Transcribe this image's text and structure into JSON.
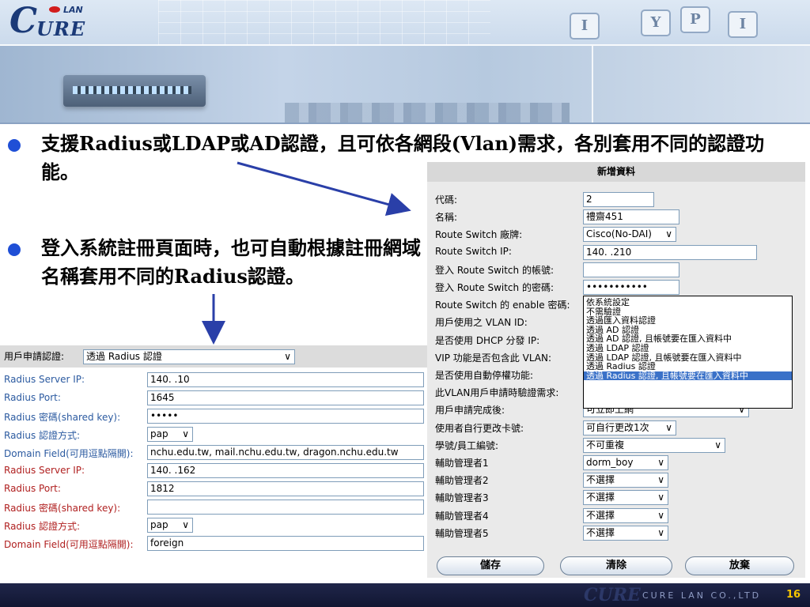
{
  "header": {
    "logo_lan": "LAN",
    "logo_c": "C",
    "logo_ure": "URE",
    "key_labels": [
      "I",
      "Y",
      "P",
      "I"
    ]
  },
  "bullets": [
    "支援Radius或LDAP或AD認證，且可依各網段(Vlan)需求，各別套用不同的認證功能。",
    "登入系統註冊頁面時，也可自動根據註冊網域名稱套用不同的Radius認證。"
  ],
  "left_panel": {
    "top_label": "用戶申請認證:",
    "top_select": "透過 Radius 認證",
    "rows": [
      {
        "label": "Radius Server IP:",
        "value": "140.      .10",
        "kind": "input",
        "color": "blue"
      },
      {
        "label": "Radius Port:",
        "value": "1645",
        "kind": "input",
        "color": "blue"
      },
      {
        "label": "Radius 密碼(shared key):",
        "value": "•••••",
        "kind": "input",
        "color": "blue"
      },
      {
        "label": "Radius 認證方式:",
        "value": "pap",
        "kind": "select",
        "color": "blue"
      },
      {
        "label": "Domain Field(可用逗點隔開):",
        "value": "nchu.edu.tw, mail.nchu.edu.tw, dragon.nchu.edu.tw",
        "kind": "input",
        "color": "blue"
      },
      {
        "label": "Radius Server IP:",
        "value": "140.      .162",
        "kind": "input",
        "color": "red"
      },
      {
        "label": "Radius Port:",
        "value": "1812",
        "kind": "input",
        "color": "red"
      },
      {
        "label": "Radius 密碼(shared key):",
        "value": "",
        "kind": "input",
        "color": "red"
      },
      {
        "label": "Radius 認證方式:",
        "value": "pap",
        "kind": "select",
        "color": "red"
      },
      {
        "label": "Domain Field(可用逗點隔開):",
        "value": "foreign",
        "kind": "input",
        "color": "red"
      }
    ]
  },
  "right_panel": {
    "title": "新增資料",
    "rows": [
      {
        "label": "代碼:",
        "value": "2",
        "kind": "input"
      },
      {
        "label": "名稱:",
        "value": "禮齋451",
        "kind": "input"
      },
      {
        "label": "Route Switch 廠牌:",
        "value": "Cisco(No-DAI)",
        "kind": "select"
      },
      {
        "label": "Route Switch IP:",
        "value": "140.       .210",
        "kind": "input"
      },
      {
        "label": "登入 Route Switch 的帳號:",
        "value": "",
        "kind": "input"
      },
      {
        "label": "登入 Route Switch 的密碼:",
        "value": "•••••••••••",
        "kind": "input"
      },
      {
        "label": "Route Switch 的 enable 密碼:",
        "value": "",
        "kind": "input"
      },
      {
        "label": "用戶使用之 VLAN ID:",
        "value": "",
        "kind": "input"
      },
      {
        "label": "是否使用 DHCP 分發 IP:",
        "value": "",
        "kind": "input"
      },
      {
        "label": "VIP 功能是否包含此 VLAN:",
        "value": "",
        "kind": "input"
      },
      {
        "label": "是否使用自動停權功能:",
        "value": "",
        "kind": "input"
      },
      {
        "label": "此VLAN用戶申請時驗證需求:",
        "value": "",
        "kind": "input"
      },
      {
        "label": "用戶申請完成後:",
        "value": "可立即上網",
        "kind": "select"
      },
      {
        "label": "使用者自行更改卡號:",
        "value": "可自行更改1次",
        "kind": "select"
      },
      {
        "label": "學號/員工編號:",
        "value": "不可重複",
        "kind": "select"
      },
      {
        "label": "輔助管理者1",
        "value": "dorm_boy",
        "kind": "select"
      },
      {
        "label": "輔助管理者2",
        "value": "不選擇",
        "kind": "select"
      },
      {
        "label": "輔助管理者3",
        "value": "不選擇",
        "kind": "select"
      },
      {
        "label": "輔助管理者4",
        "value": "不選擇",
        "kind": "select"
      },
      {
        "label": "輔助管理者5",
        "value": "不選擇",
        "kind": "select"
      }
    ],
    "dropdown_options": [
      "依系統設定",
      "不需驗證",
      "透過匯入資料認證",
      "透過 AD 認證",
      "透過 AD 認證, 且帳號要在匯入資料中",
      "透過 LDAP 認證",
      "透過 LDAP 認證, 且帳號要在匯入資料中",
      "透過 Radius 認證",
      "透過 Radius 認證, 且帳號要在匯入資料中"
    ],
    "dropdown_selected_index": 8,
    "buttons": {
      "save": "儲存",
      "clear": "清除",
      "cancel": "放棄"
    }
  },
  "footer": {
    "logo": "CURE",
    "company": "CURE LAN CO.,LTD",
    "page": "16"
  },
  "colors": {
    "blue_label": "#2b5aa0",
    "red_label": "#b02020",
    "bullet_dot": "#1f4fd6",
    "arrow": "#2a3fa8",
    "highlight": "#3a71c8",
    "redbox": "#d61b1b"
  }
}
